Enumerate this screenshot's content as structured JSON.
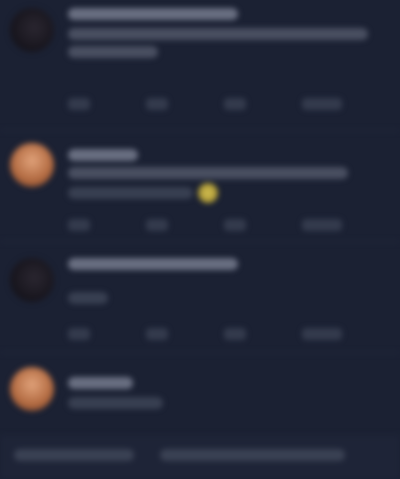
{
  "feed": {
    "posts": [
      {
        "author": "",
        "handle": "",
        "text": "",
        "reply_label": "",
        "like_label": "",
        "repost_label": "",
        "views_label": ""
      },
      {
        "author": "",
        "handle": "",
        "text": "",
        "reply_label": "",
        "like_label": "",
        "repost_label": "",
        "views_label": ""
      },
      {
        "author": "",
        "handle": "",
        "text": "",
        "reply_label": "",
        "like_label": "",
        "repost_label": "",
        "views_label": ""
      },
      {
        "author": "",
        "handle": "",
        "text": "",
        "reply_label": "",
        "like_label": "",
        "repost_label": "",
        "views_label": ""
      }
    ]
  },
  "composer": {
    "placeholder": "",
    "send_label": ""
  },
  "colors": {
    "background": "#1b2133",
    "text_muted": "#7d8497",
    "emoji_yellow": "#d6c255",
    "avatar_warm": "#c98056"
  }
}
